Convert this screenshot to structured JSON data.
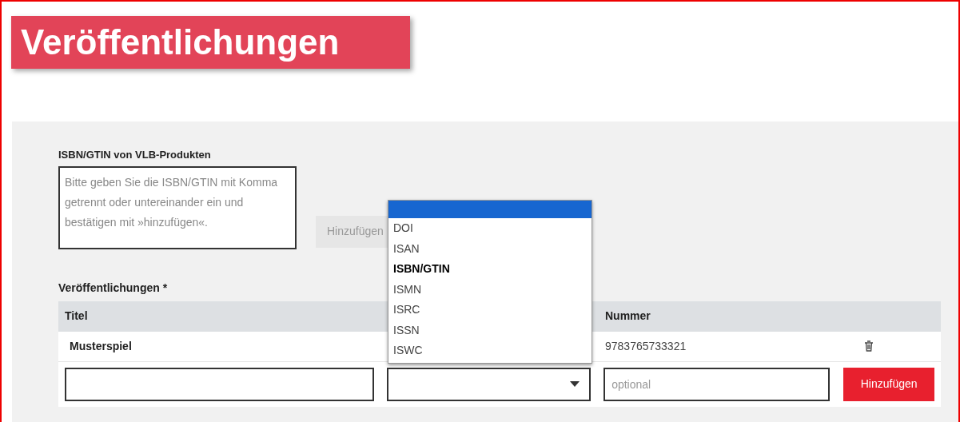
{
  "banner": {
    "title": "Veröffentlichungen"
  },
  "isbn_section": {
    "label": "ISBN/GTIN von VLB-Produkten",
    "placeholder": "Bitte geben Sie die ISBN/GTIN mit Komma getrennt oder untereinander ein und bestätigen mit »hinzufügen«.",
    "button": {
      "label": "Hinzufügen",
      "disabled": true
    }
  },
  "publications": {
    "label": "Veröffentlichungen *",
    "table": {
      "columns": [
        "Titel",
        "Nummer"
      ],
      "rows": [
        {
          "title": "Musterspiel",
          "number": "9783765733321"
        }
      ]
    },
    "new_row": {
      "number_placeholder": "optional",
      "button": "Hinzufügen"
    }
  },
  "dropdown": {
    "blank_option_highlighted": true,
    "options": [
      {
        "label": "DOI",
        "selected": false
      },
      {
        "label": "ISAN",
        "selected": false
      },
      {
        "label": "ISBN/GTIN",
        "selected": true
      },
      {
        "label": "ISMN",
        "selected": false
      },
      {
        "label": "ISRC",
        "selected": false
      },
      {
        "label": "ISSN",
        "selected": false
      },
      {
        "label": "ISWC",
        "selected": false
      }
    ]
  }
}
